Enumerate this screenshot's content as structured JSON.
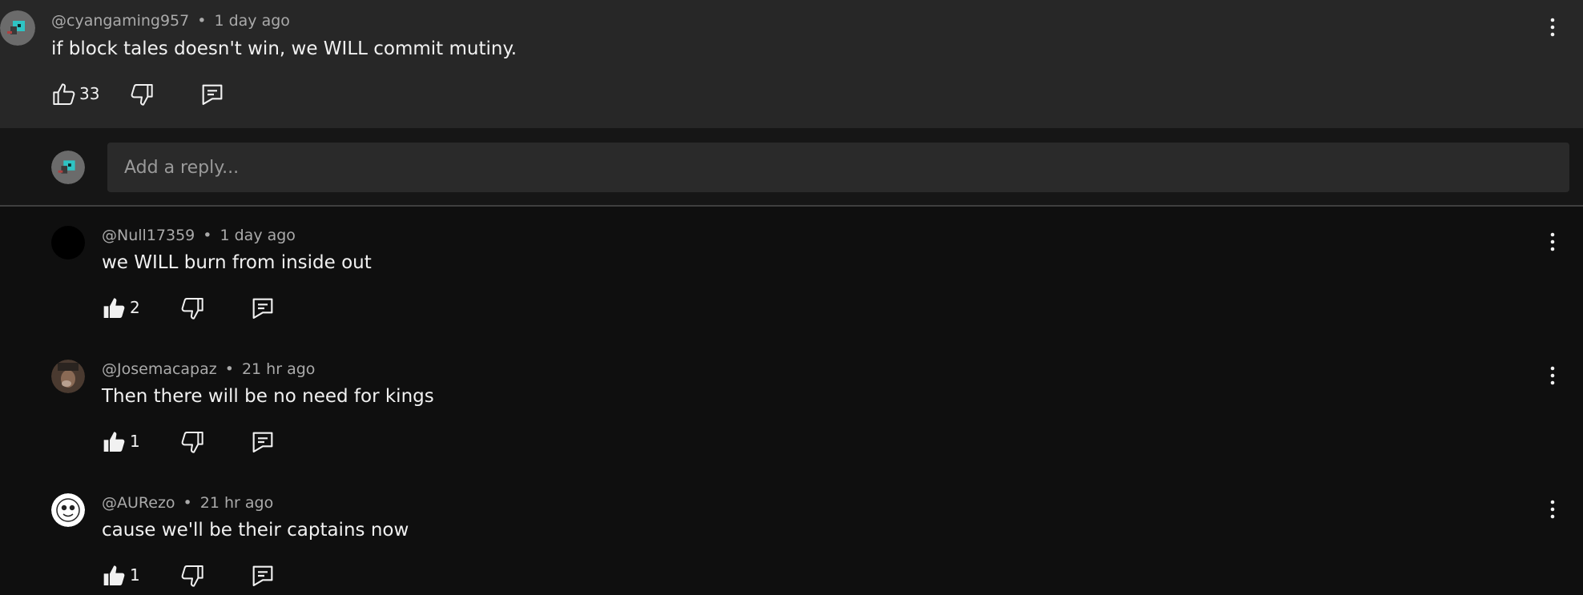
{
  "top_comment": {
    "handle": "@cyangaming957",
    "time": "1 day ago",
    "text": "if block tales doesn't win, we WILL commit mutiny.",
    "likes": "33"
  },
  "reply_box": {
    "placeholder": "Add a reply..."
  },
  "replies": [
    {
      "handle": "@Null17359",
      "time": "1 day ago",
      "text": "we WILL burn from inside out",
      "likes": "2"
    },
    {
      "handle": "@Josemacapaz",
      "time": "21 hr ago",
      "text": "Then there will be no need for kings",
      "likes": "1"
    },
    {
      "handle": "@AURezo",
      "time": "21 hr ago",
      "text": "cause we'll be their captains now",
      "likes": "1"
    }
  ],
  "separator": "•",
  "icons": {
    "like": "thumbs-up-icon",
    "dislike": "thumbs-down-icon",
    "reply": "comment-icon",
    "more": "more-vertical-icon"
  },
  "colors": {
    "top_background": "#272727",
    "page_background": "#0f0f0f",
    "input_background": "#2a2a2a",
    "text": "#f1f1f1",
    "muted": "#aaaaaa"
  }
}
